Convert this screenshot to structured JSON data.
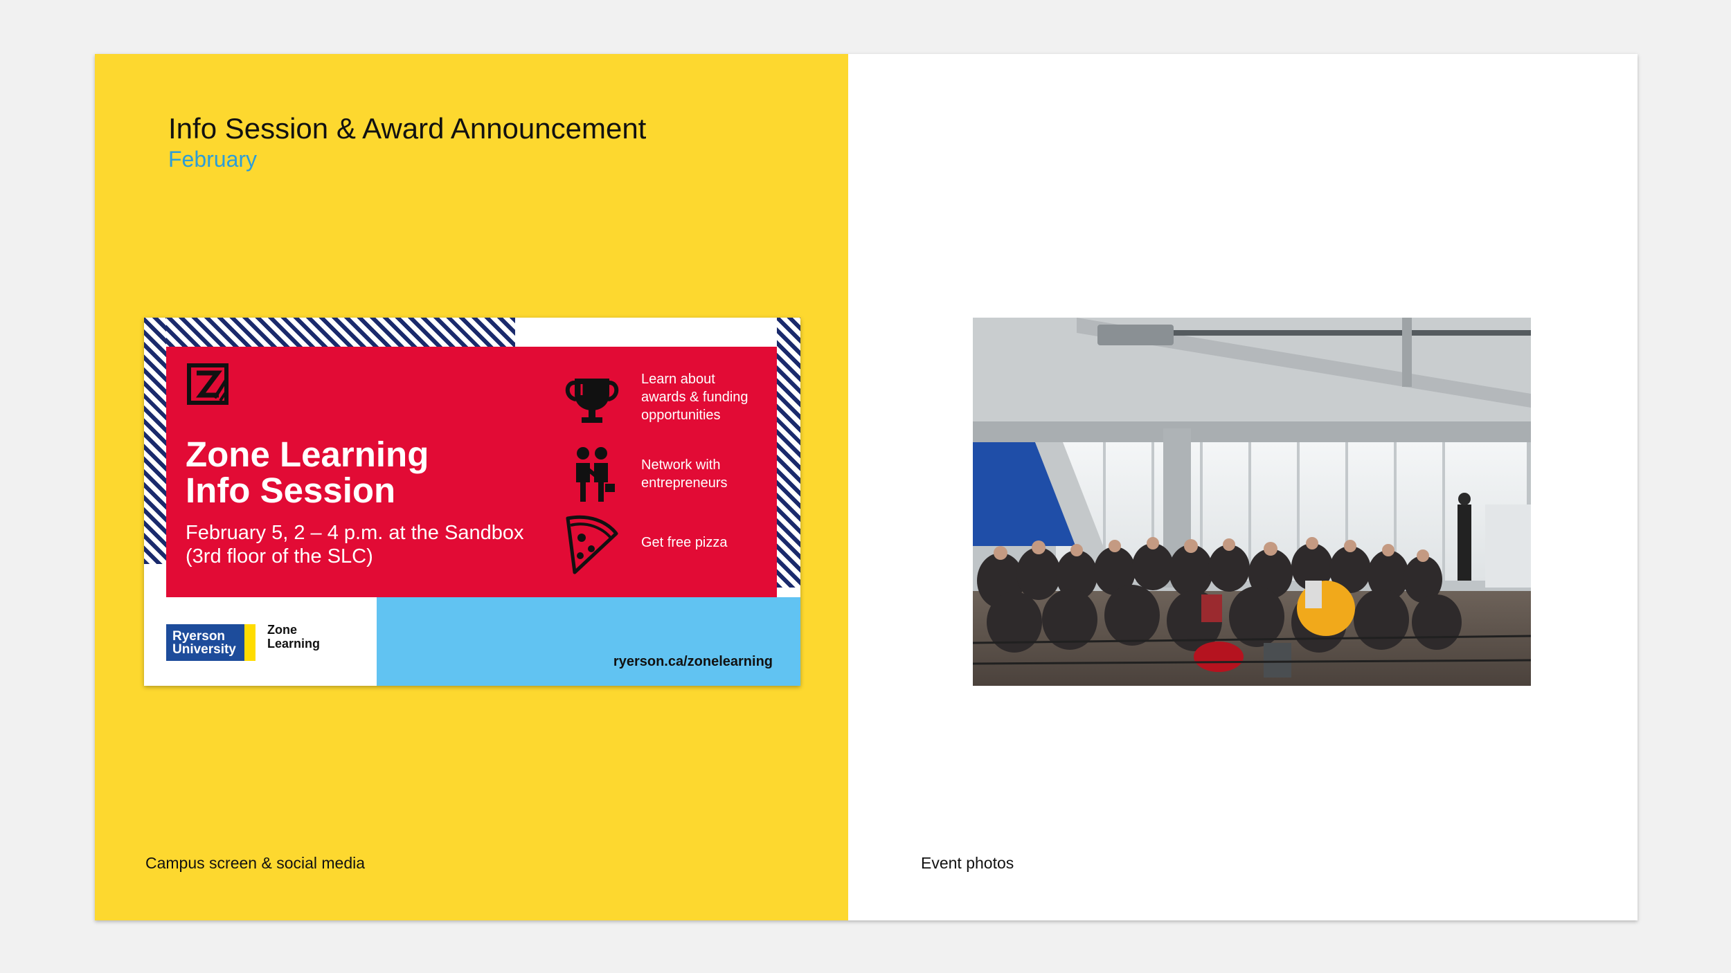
{
  "slide": {
    "title": "Info Session & Award Announcement",
    "subtitle": "February",
    "left_caption": "Campus screen & social media",
    "right_caption": "Event photos"
  },
  "poster": {
    "headline_line1": "Zone Learning",
    "headline_line2": "Info Session",
    "details_line1": "February 5, 2 – 4 p.m. at the Sandbox",
    "details_line2": "(3rd floor of the SLC)",
    "features": [
      {
        "icon": "trophy-icon",
        "lines": [
          "Learn about",
          "awards & funding",
          "opportunities"
        ]
      },
      {
        "icon": "handshake-icon",
        "lines": [
          "Network with",
          "entrepreneurs"
        ]
      },
      {
        "icon": "pizza-icon",
        "lines": [
          "Get free pizza"
        ]
      }
    ],
    "university_line1": "Ryerson",
    "university_line2": "University",
    "zone_line1": "Zone",
    "zone_line2": "Learning",
    "url": "ryerson.ca/zonelearning"
  },
  "colors": {
    "panel_yellow": "#fdd82f",
    "poster_red": "#e20b35",
    "poster_blue": "#61c3f2",
    "stripe_navy": "#1a2a6c",
    "subtitle_blue": "#2c9dd8"
  }
}
